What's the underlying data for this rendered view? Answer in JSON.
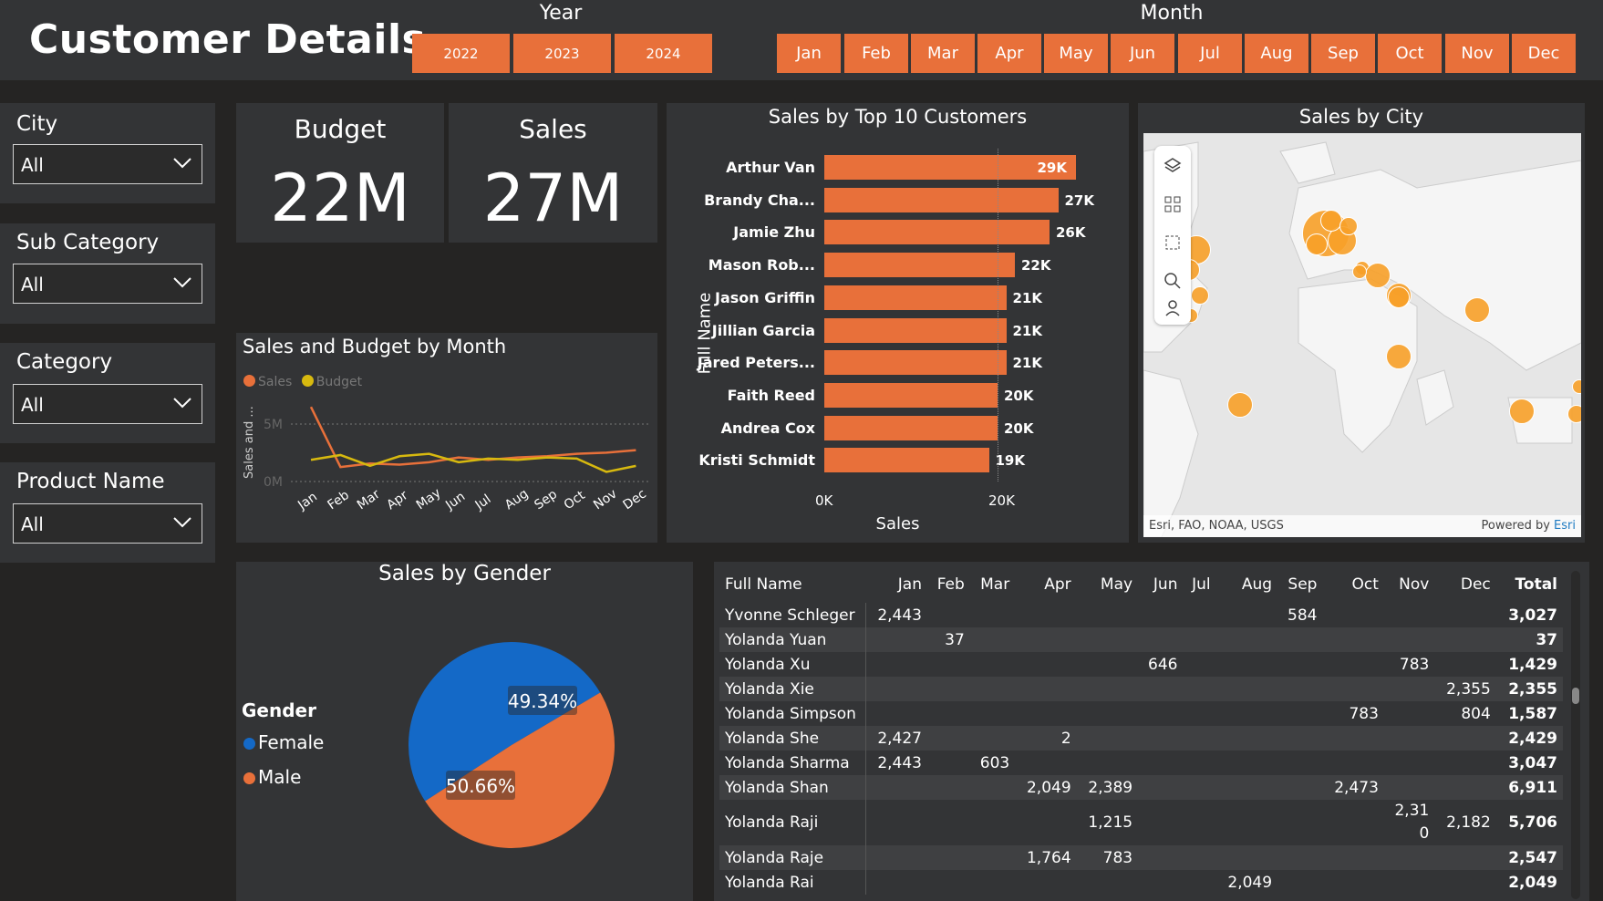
{
  "title": "Customer Details",
  "year_slicer": {
    "label": "Year",
    "options": [
      "2022",
      "2023",
      "2024"
    ]
  },
  "month_slicer": {
    "label": "Month",
    "options": [
      "Jan",
      "Feb",
      "Mar",
      "Apr",
      "May",
      "Jun",
      "Jul",
      "Aug",
      "Sep",
      "Oct",
      "Nov",
      "Dec"
    ]
  },
  "filters": [
    {
      "label": "City",
      "value": "All"
    },
    {
      "label": "Sub Category",
      "value": "All"
    },
    {
      "label": "Category",
      "value": "All"
    },
    {
      "label": "Product Name",
      "value": "All"
    }
  ],
  "kpis": {
    "budget": {
      "label": "Budget",
      "value": "22M"
    },
    "sales": {
      "label": "Sales",
      "value": "27M"
    }
  },
  "line_chart": {
    "title": "Sales and Budget by Month",
    "legend": [
      "Sales",
      "Budget"
    ],
    "ylabel": "Sales and ...",
    "yticks": [
      "5M",
      "0M"
    ],
    "colors": {
      "sales": "#e8703a",
      "budget": "#d7b90f"
    }
  },
  "bar_chart": {
    "title": "Sales by Top 10 Customers",
    "ylabel": "Full Name",
    "xlabel": "Sales",
    "xticks": [
      "0K",
      "20K"
    ]
  },
  "map": {
    "title": "Sales by City",
    "attribution": "Esri, FAO, NOAA, USGS",
    "powered": "Powered by",
    "esri": "Esri"
  },
  "pie": {
    "title": "Sales by Gender",
    "legend_title": "Gender",
    "legend": [
      "Female",
      "Male"
    ],
    "labels": {
      "female": "50.66%",
      "male": "49.34%"
    },
    "colors": {
      "female": "#1469c7",
      "male": "#e8703a"
    }
  },
  "matrix": {
    "headers": [
      "Full Name",
      "Jan",
      "Feb",
      "Mar",
      "Apr",
      "May",
      "Jun",
      "Jul",
      "Aug",
      "Sep",
      "Oct",
      "Nov",
      "Dec",
      "Total"
    ],
    "rows": [
      [
        "Yvonne Schleger",
        "2,443",
        "",
        "",
        "",
        "",
        "",
        "",
        "",
        "584",
        "",
        "",
        "",
        "3,027"
      ],
      [
        "Yolanda Yuan",
        "",
        "37",
        "",
        "",
        "",
        "",
        "",
        "",
        "",
        "",
        "",
        "",
        "37"
      ],
      [
        "Yolanda Xu",
        "",
        "",
        "",
        "",
        "",
        "646",
        "",
        "",
        "",
        "",
        "783",
        "",
        "1,429"
      ],
      [
        "Yolanda Xie",
        "",
        "",
        "",
        "",
        "",
        "",
        "",
        "",
        "",
        "",
        "",
        "2,355",
        "2,355"
      ],
      [
        "Yolanda Simpson",
        "",
        "",
        "",
        "",
        "",
        "",
        "",
        "",
        "",
        "783",
        "",
        "804",
        "1,587"
      ],
      [
        "Yolanda She",
        "2,427",
        "",
        "",
        "2",
        "",
        "",
        "",
        "",
        "",
        "",
        "",
        "",
        "2,429"
      ],
      [
        "Yolanda Sharma",
        "2,443",
        "",
        "603",
        "",
        "",
        "",
        "",
        "",
        "",
        "",
        "",
        "",
        "3,047"
      ],
      [
        "Yolanda Shan",
        "",
        "",
        "",
        "2,049",
        "2,389",
        "",
        "",
        "",
        "",
        "2,473",
        "",
        "",
        "6,911"
      ],
      [
        "Yolanda Raji",
        "",
        "",
        "",
        "",
        "1,215",
        "",
        "",
        "",
        "",
        "",
        "2,31\n0",
        "2,182",
        "5,706"
      ],
      [
        "Yolanda Raje",
        "",
        "",
        "",
        "1,764",
        "783",
        "",
        "",
        "",
        "",
        "",
        "",
        "",
        "2,547"
      ],
      [
        "Yolanda Rai",
        "",
        "",
        "",
        "",
        "",
        "",
        "",
        "2,049",
        "",
        "",
        "",
        "",
        "2,049"
      ]
    ]
  },
  "chart_data": [
    {
      "type": "bar",
      "title": "Sales by Top 10 Customers",
      "xlabel": "Sales",
      "ylabel": "Full Name",
      "categories": [
        "Arthur Van",
        "Brandy Cha...",
        "Jamie Zhu",
        "Mason Rob...",
        "Jason Griffin",
        "Jillian Garcia",
        "Jared Peters...",
        "Faith Reed",
        "Andrea Cox",
        "Kristi Schmidt"
      ],
      "values": [
        29,
        27,
        26,
        22,
        21,
        21,
        21,
        20,
        20,
        19
      ],
      "value_labels": [
        "29K",
        "27K",
        "26K",
        "22K",
        "21K",
        "21K",
        "21K",
        "20K",
        "20K",
        "19K"
      ],
      "xlim": [
        0,
        32
      ]
    },
    {
      "type": "line",
      "title": "Sales and Budget by Month",
      "categories": [
        "Jan",
        "Feb",
        "Mar",
        "Apr",
        "May",
        "Jun",
        "Jul",
        "Aug",
        "Sep",
        "Oct",
        "Nov",
        "Dec"
      ],
      "series": [
        {
          "name": "Sales",
          "values": [
            6.2,
            1.2,
            1.5,
            1.4,
            1.6,
            2.0,
            1.8,
            2.0,
            2.1,
            2.3,
            2.4,
            2.6
          ]
        },
        {
          "name": "Budget",
          "values": [
            1.8,
            2.2,
            1.3,
            2.1,
            2.3,
            1.6,
            1.9,
            1.8,
            2.0,
            1.9,
            0.8,
            1.3
          ]
        }
      ],
      "ylim": [
        0,
        6.5
      ]
    },
    {
      "type": "pie",
      "title": "Sales by Gender",
      "categories": [
        "Female",
        "Male"
      ],
      "values": [
        50.66,
        49.34
      ]
    }
  ]
}
